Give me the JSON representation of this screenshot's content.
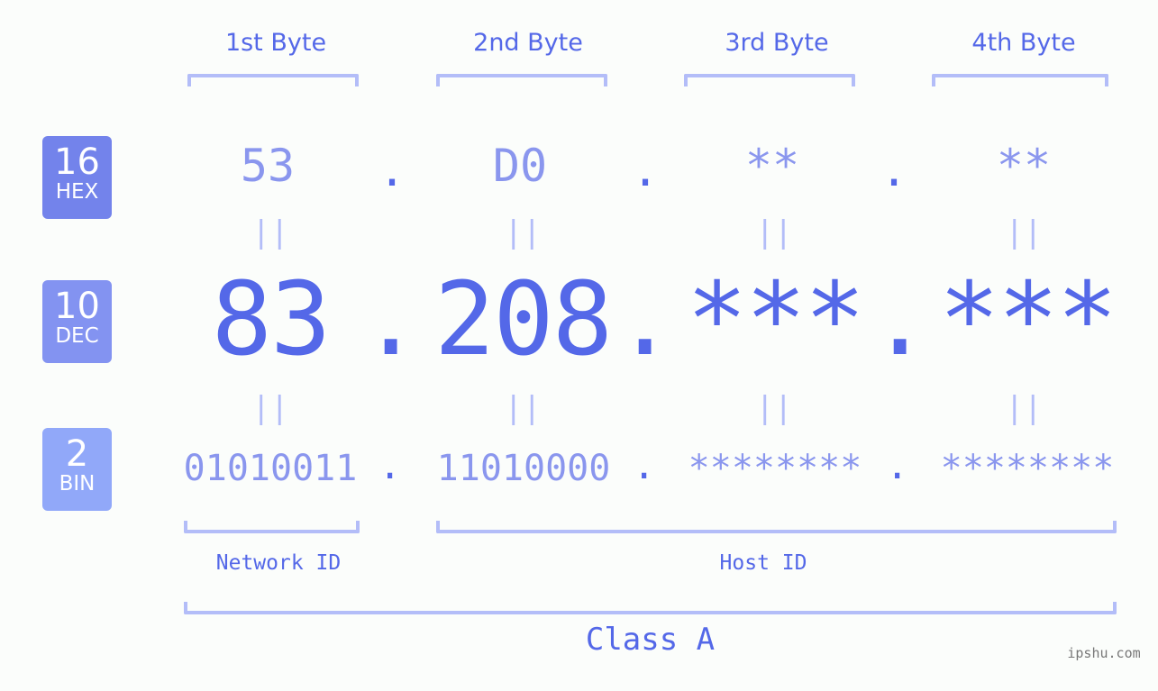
{
  "byte_headers": [
    "1st Byte",
    "2nd Byte",
    "3rd Byte",
    "4th Byte"
  ],
  "badges": {
    "hex": {
      "number": "16",
      "label": "HEX",
      "color": "#7383eb"
    },
    "dec": {
      "number": "10",
      "label": "DEC",
      "color": "#8393f1"
    },
    "bin": {
      "number": "2",
      "label": "BIN",
      "color": "#91a8f9"
    }
  },
  "hex_values": [
    "53",
    "D0",
    "**",
    "**"
  ],
  "dec_values": [
    "83",
    "208",
    "***",
    "***"
  ],
  "bin_values": [
    "01010011",
    "11010000",
    "********",
    "********"
  ],
  "separator": ".",
  "equals_sign": "||",
  "network_id_label": "Network ID",
  "host_id_label": "Host ID",
  "class_label": "Class A",
  "watermark": "ipshu.com",
  "colors": {
    "primary": "#5468e8",
    "secondary": "#8a96ee",
    "bracket": "#b3bdf8",
    "background": "#fbfdfb"
  }
}
